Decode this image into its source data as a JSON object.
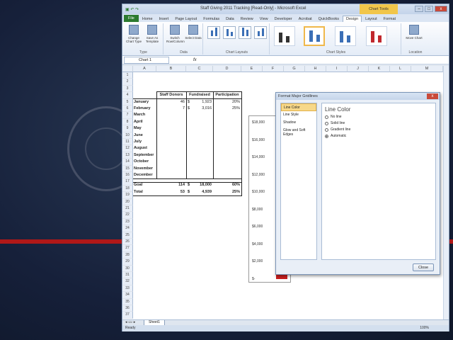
{
  "window": {
    "title": "Staff Giving 2011 Tracking  [Read-Only]  -  Microsoft Excel",
    "chart_tools": "Chart Tools"
  },
  "ribbon_tabs": [
    "File",
    "Home",
    "Insert",
    "Page Layout",
    "Formulas",
    "Data",
    "Review",
    "View",
    "Developer",
    "Acrobat",
    "QuickBooks",
    "Design",
    "Layout",
    "Format"
  ],
  "ribbon": {
    "change_chart_type": "Change Chart Type",
    "save_as_template": "Save As Template",
    "switch_row_column": "Switch Row/Column",
    "select_data": "Select Data",
    "move_chart": "Move Chart",
    "groups": [
      "Type",
      "Data",
      "Chart Layouts",
      "Chart Styles",
      "Location"
    ]
  },
  "name_box": "Chart 1",
  "fx": "fx",
  "columns": [
    "A",
    "B",
    "C",
    "D",
    "E",
    "F",
    "G",
    "H",
    "I",
    "J",
    "K",
    "L",
    "M"
  ],
  "rows": [
    "1",
    "2",
    "3",
    "4",
    "5",
    "6",
    "7",
    "8",
    "9",
    "10",
    "11",
    "12",
    "13",
    "14",
    "15",
    "16",
    "17",
    "18",
    "19",
    "20",
    "21",
    "22",
    "23",
    "24",
    "25",
    "26",
    "27",
    "28",
    "29",
    "30",
    "31",
    "32",
    "33",
    "34",
    "35",
    "36",
    "37"
  ],
  "table": {
    "headers": [
      "Staff Donors",
      "Fundraised",
      "Participation"
    ],
    "months": [
      "January",
      "February",
      "March",
      "April",
      "May",
      "June",
      "July",
      "August",
      "September",
      "October",
      "November",
      "December"
    ],
    "jan": {
      "donors": "46",
      "dollar": "$",
      "amount": "1,923",
      "pct": "20%"
    },
    "feb": {
      "donors": "7",
      "dollar": "$",
      "amount": "3,016",
      "pct": "25%"
    },
    "goal": {
      "label": "Goal",
      "donors": "114",
      "dollar": "$",
      "amount": "18,000",
      "pct": "60%"
    },
    "total": {
      "label": "Total",
      "donors": "53",
      "dollar": "$",
      "amount": "4,939",
      "pct": "25%"
    }
  },
  "chart_ticks": [
    "$18,000",
    "$16,000",
    "$14,000",
    "$12,000",
    "$10,000",
    "$8,000",
    "$6,000",
    "$4,000",
    "$2,000",
    "$-"
  ],
  "dialog": {
    "title": "Format Major Gridlines",
    "close_x": "x",
    "categories": [
      "Line Color",
      "Line Style",
      "Shadow",
      "Glow and Soft Edges"
    ],
    "panel_heading": "Line Color",
    "options": [
      "No line",
      "Solid line",
      "Gradient line",
      "Automatic"
    ],
    "close_button": "Close"
  },
  "sheet_tab": "Sheet1",
  "status": "Ready",
  "zoom": "100%"
}
